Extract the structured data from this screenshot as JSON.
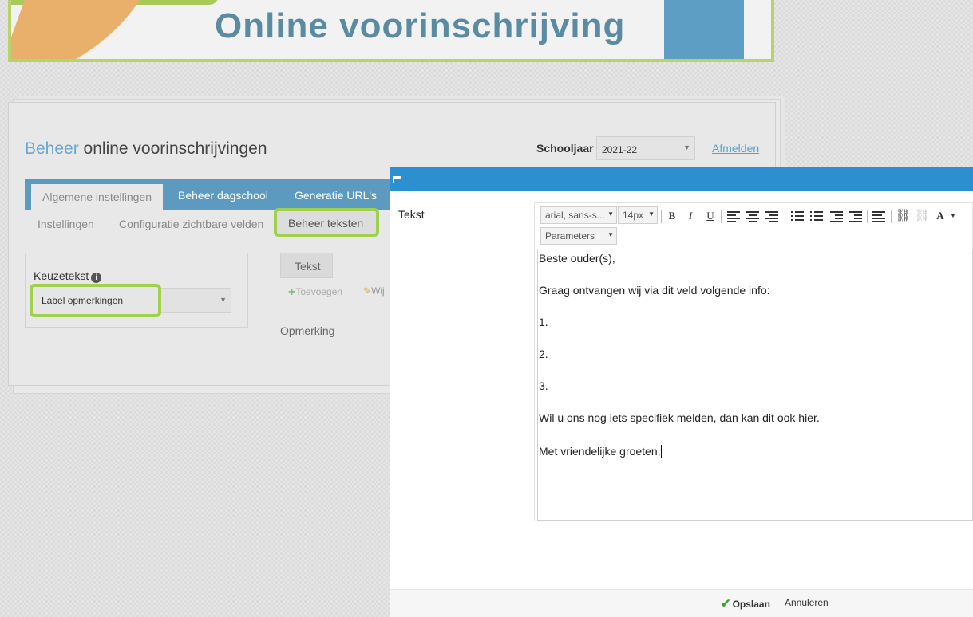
{
  "banner": {
    "title": "Online voorinschrijving"
  },
  "header": {
    "title_accent": "Beheer",
    "title_rest": " online voorinschrijvingen",
    "schoolyear_label": "Schooljaar",
    "schoolyear_value": "2021-22",
    "logout": "Afmelden"
  },
  "tabs": [
    {
      "label": "Algemene instellingen",
      "active": true
    },
    {
      "label": "Beheer dagschool"
    },
    {
      "label": "Generatie URL's"
    }
  ],
  "subtabs": [
    {
      "label": "Instellingen"
    },
    {
      "label": "Configuratie zichtbare velden"
    },
    {
      "label": "Beheer teksten",
      "highlighted": true
    }
  ],
  "keuze": {
    "label": "Keuzetekst",
    "selected": "Label opmerkingen"
  },
  "text_panel": {
    "tab": "Tekst",
    "add_label": "Toevoegen",
    "edit_label": "Wij",
    "row_label": "Opmerking"
  },
  "modal": {
    "field_label": "Tekst",
    "toolbar": {
      "font": "arial, sans-s...",
      "size": "14px",
      "parameters": "Parameters"
    },
    "content": [
      "Beste ouder(s),",
      "Graag ontvangen wij via dit veld volgende info:",
      "1.",
      "2.",
      "3.",
      "Wil u ons nog iets specifiek melden, dan kan dit ook hier.",
      "Met vriendelijke groeten,"
    ],
    "save": "Opslaan",
    "cancel": "Annuleren"
  },
  "colors": {
    "accent": "#2b8fd0",
    "highlight": "#9fd14f",
    "tabbar": "#5c9ac0"
  }
}
